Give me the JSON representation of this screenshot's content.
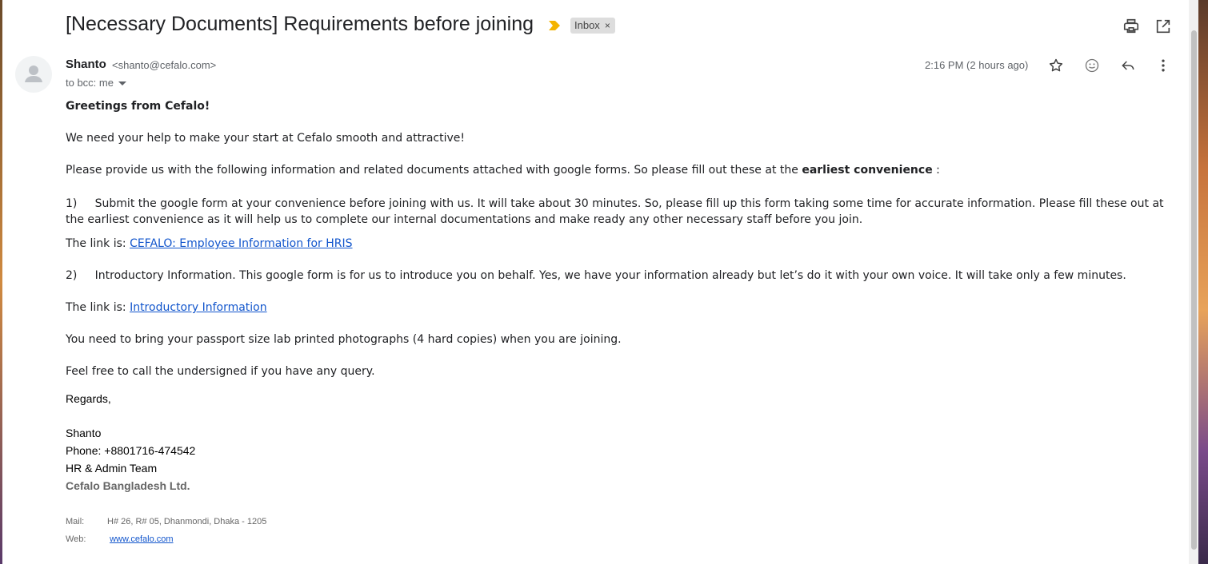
{
  "email": {
    "subject": "[Necessary Documents] Requirements before joining",
    "label_chip": "Inbox",
    "label_chip_close": "×",
    "sender": {
      "name": "Shanto",
      "email": "<shanto@cefalo.com>"
    },
    "to_line": "to bcc: me",
    "time": "2:16 PM (2 hours ago)"
  },
  "body": {
    "greeting": "Greetings from Cefalo!",
    "intro": "We need your help to make your start at Cefalo smooth and attractive!",
    "request_prefix": "Please provide us with the following information and related documents attached with google forms. So please fill out these at the ",
    "request_bold": "earliest convenience",
    "request_suffix": " :",
    "item1_num": "1)",
    "item1_text": "Submit the google form at your convenience before joining with us. It will take about 30 minutes. So, please fill up this form taking some time for accurate information. Please fill these out at the earliest convenience as it will help  us to complete our internal documentations and make ready any other necessary staff before you join.",
    "link_prefix": "The link is: ",
    "link1_text": "CEFALO: Employee Information for HRIS",
    "item2_num": "2)",
    "item2_text": "Introductory Information. This google form is for us to introduce you on behalf. Yes, we have your information already but let’s do it with your own voice. It will take only a few minutes.",
    "link2_text": "Introductory Information",
    "photos": "You need to bring your passport size lab printed photographs (4 hard copies) when you are joining.",
    "query": "Feel free to call the undersigned if you have any query."
  },
  "signature": {
    "regards": "Regards,",
    "name": "Shanto",
    "phone": "Phone: +8801716-474542",
    "team": "HR & Admin Team",
    "company": "Cefalo Bangladesh Ltd.",
    "mail_label": "Mail:",
    "mail_value": "H# 26, R# 05, Dhanmondi, Dhaka - 1205",
    "web_label": "Web:",
    "web_value": "www.cefalo.com"
  },
  "colors": {
    "importance": "#f4b400",
    "link": "#1155cc"
  },
  "icons": [
    "importance-marker-icon",
    "print-icon",
    "open-in-new-window-icon",
    "avatar-icon",
    "star-icon",
    "emoji-reaction-icon",
    "reply-icon",
    "more-options-icon"
  ]
}
